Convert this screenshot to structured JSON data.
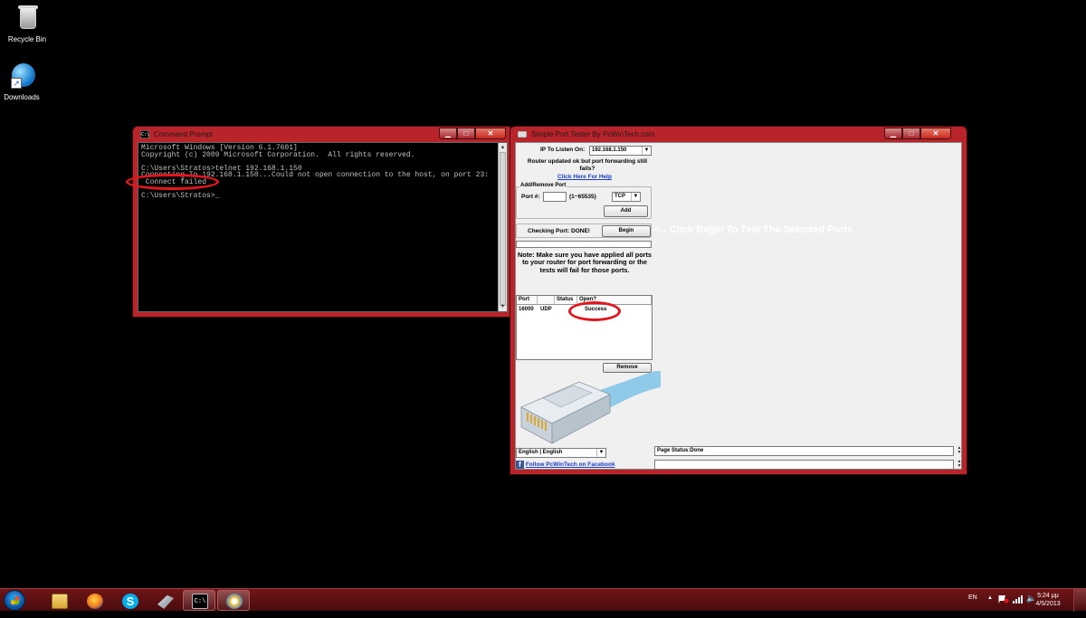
{
  "desktop": {
    "icons": [
      {
        "label": "Recycle Bin"
      },
      {
        "label": "Downloads"
      }
    ]
  },
  "cmd": {
    "title": "Command Prompt",
    "lines": [
      "Microsoft Windows [Version 6.1.7601]",
      "Copyright (c) 2009 Microsoft Corporation.  All rights reserved.",
      "",
      "C:\\Users\\Stratos>telnet 192.168.1.150",
      "Connecting To 192.168.1.150...Could not open connection to the host, on port 23:",
      " Connect failed",
      "",
      "C:\\Users\\Stratos>_"
    ]
  },
  "port_tester": {
    "title": "Simple Port Tester By PcWinTech.com",
    "ip_label": "IP To Listen On:",
    "ip_value": "192.168.1.150",
    "router_note": "Router updated ok but port forwarding still fails?",
    "help_link": "Click Here For Help",
    "add_remove_group": "Add/Remove Port",
    "port_label": "Port #:",
    "port_value": "",
    "port_range": "(1~65535)",
    "protocol_value": "TCP",
    "add_button": "Add",
    "checking_label": "Checking Port: DONE!",
    "begin_button": "Begin",
    "begin_hint": "<-- Click Begin To Test The Selected Ports",
    "note": "Note: Make sure you have applied all ports to your router for port forwarding or the tests will fail for those ports.",
    "table": {
      "headers": [
        "Port",
        "",
        "Status",
        "Open?"
      ],
      "rows": [
        {
          "port": "16000",
          "proto": "UDP",
          "status": "",
          "open": "Success"
        }
      ]
    },
    "remove_button": "Remove",
    "language_value": "English | English",
    "facebook_link": "Follow PcWinTech on Facebook",
    "page_status": "Page Status:Done",
    "page_status_2": ""
  },
  "taskbar": {
    "language": "EN",
    "time": "5:24 μμ",
    "date": "4/5/2013"
  },
  "colors": {
    "window_frame": "#b9232a",
    "annotation_red": "#e3161d",
    "taskbar": "#5a0e11",
    "link_blue": "#1a3cc8"
  }
}
